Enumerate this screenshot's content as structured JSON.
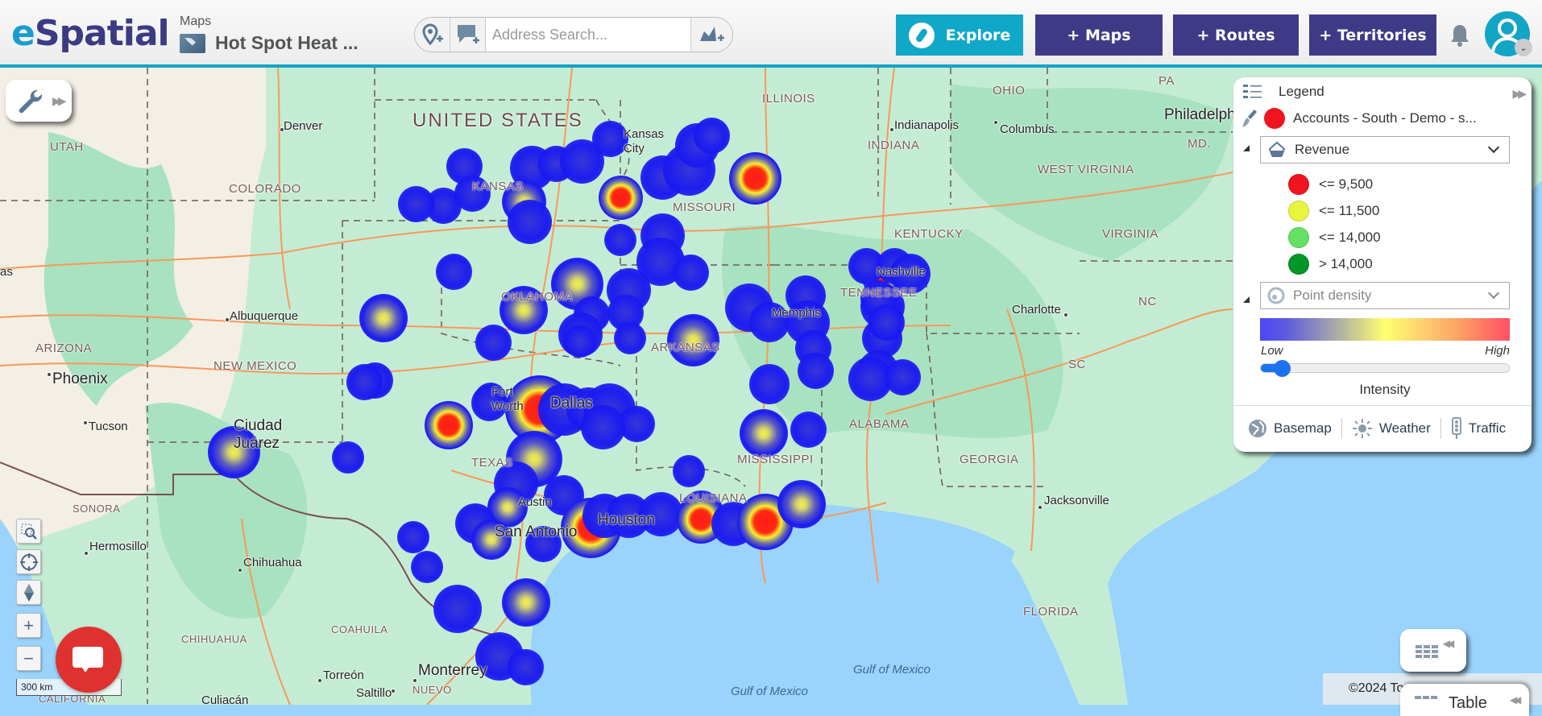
{
  "header": {
    "logo_e": "e",
    "logo_rest": "Spatial",
    "breadcrumb": "Maps",
    "map_title": "Hot Spot Heat ...",
    "search_placeholder": "Address Search...",
    "search_value": "",
    "toolbar_icons": [
      "add-pin-icon",
      "add-comment-icon",
      "add-territory-icon"
    ],
    "nav": {
      "explore": "Explore",
      "maps": "+ Maps",
      "routes": "+ Routes",
      "territories": "+ Territories"
    },
    "accent_color": "#12a5c6",
    "nav_color": "#3f3a86"
  },
  "map": {
    "country_label": "UNITED STATES",
    "states": [
      "UTAH",
      "COLORADO",
      "KANSAS",
      "MISSOURI",
      "ILLINOIS",
      "INDIANA",
      "OHIO",
      "PA",
      "MD.",
      "WEST VIRGINIA",
      "VIRGINIA",
      "KENTUCKY",
      "TENNESSEE",
      "NC",
      "SC",
      "GEORGIA",
      "ALABAMA",
      "MISSISSIPPI",
      "ARKANSAS",
      "OKLAHOMA",
      "TEXAS",
      "LOUISIANA",
      "FLORIDA",
      "NEW MEXICO",
      "ARIZONA",
      "SONORA",
      "CHIHUAHUA",
      "COAHUILA",
      "NUEVO",
      "CALIFORNIA"
    ],
    "cities": [
      "Denver",
      "Kansas City",
      "Indianapolis",
      "Columbus",
      "Philadelphia",
      "Nashville",
      "Memphis",
      "Charlotte",
      "Albuquerque",
      "Phoenix",
      "Tucson",
      "Ciudad Juárez",
      "Fort Worth",
      "Dallas",
      "Austin",
      "San Antonio",
      "Houston",
      "Jacksonville",
      "Hermosillo",
      "Chihuahua",
      "Torreón",
      "Monterrey",
      "Saltillo",
      "Culiacán",
      "as"
    ],
    "water": [
      "Gulf of Mexico",
      "Gulf of Mexico"
    ],
    "scale": "300 km",
    "controls": [
      "zoom-box-icon",
      "locate-icon",
      "compass-icon",
      "zoom-in-icon",
      "zoom-out-icon"
    ],
    "zoom_in": "+",
    "zoom_out": "−"
  },
  "legend": {
    "title": "Legend",
    "layer_name": "Accounts - South - Demo - s...",
    "layer_color": "#f0141e",
    "style_field": "Revenue",
    "classes": [
      {
        "label": "<= 9,500",
        "color": "#f0141e"
      },
      {
        "label": "<= 11,500",
        "color": "#e8f53c"
      },
      {
        "label": "<= 14,000",
        "color": "#64e164"
      },
      {
        "label": "> 14,000",
        "color": "#009628"
      }
    ],
    "heatmap_mode": "Point density",
    "gradient_low": "Low",
    "gradient_high": "High",
    "intensity_label": "Intensity",
    "intensity_value": 0.05,
    "footer": {
      "basemap": "Basemap",
      "weather": "Weather",
      "traffic": "Traffic"
    }
  },
  "bottom": {
    "copyright": "©2024 To",
    "table_label": "Table"
  }
}
